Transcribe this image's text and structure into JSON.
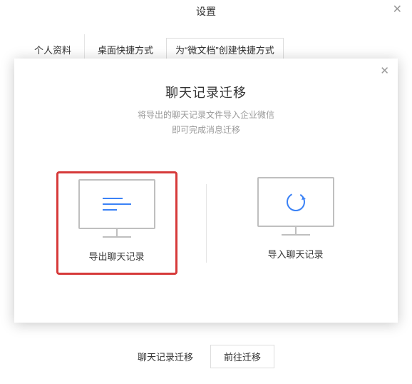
{
  "header": {
    "title": "设置"
  },
  "tabs": {
    "profile": "个人资料",
    "shortcut": "桌面快捷方式",
    "create": "为“微文档”创建快捷方式"
  },
  "bottom": {
    "label": "聊天记录迁移",
    "button": "前往迁移"
  },
  "dialog": {
    "title": "聊天记录迁移",
    "sub1": "将导出的聊天记录文件导入企业微信",
    "sub2": "即可完成消息迁移",
    "export_label": "导出聊天记录",
    "import_label": "导入聊天记录"
  }
}
